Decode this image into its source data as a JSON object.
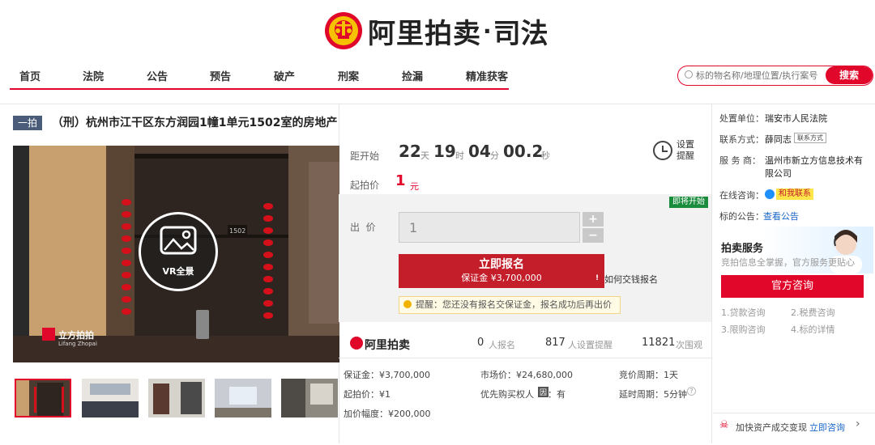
{
  "header": {
    "logo_text": "阿里拍卖",
    "logo_sep": "·",
    "logo_sub": "司法"
  },
  "nav": {
    "items": [
      "首页",
      "法院",
      "公告",
      "预告",
      "破产",
      "刑案",
      "捡漏",
      "精准获客"
    ]
  },
  "search": {
    "placeholder": "标的物名称/地理位置/执行案号",
    "button": "搜索"
  },
  "listing": {
    "badge": "一拍",
    "title": "（刑）杭州市江干区东方润园1幢1单元1502室的房地产"
  },
  "photo": {
    "vr_label": "VR全景",
    "watermark": "立方拍拍",
    "watermark_en": "Lifang Zhopai",
    "room_number": "1502"
  },
  "auction": {
    "countdown_label": "距开始",
    "days": "22",
    "days_unit": "天",
    "hours": "19",
    "hours_unit": "时",
    "minutes": "04",
    "minutes_unit": "分",
    "seconds": "00.2",
    "seconds_unit": "秒",
    "set_remind_1": "设置",
    "set_remind_2": "提醒",
    "start_label": "起拍价",
    "start_price": "1",
    "start_unit": "元",
    "soon_badge": "即将开始",
    "bid_label": "出  价",
    "bid_value": "1",
    "plus": "+",
    "minus": "−",
    "register_main": "立即报名",
    "register_sub": "保证金 ¥3,700,000",
    "how_text": "如何交钱报名",
    "remind_text": "提醒：您还没有报名交保证金，报名成功后再出价"
  },
  "stats": {
    "brand": "阿里拍卖",
    "registered_count": "0",
    "registered_label": "人报名",
    "remind_count": "817",
    "remind_label": "人设置提醒",
    "views_count": "11821",
    "views_label": "次围观"
  },
  "details": {
    "deposit": "保证金：¥3,700,000",
    "market": "市场价：¥24,680,000",
    "period": "竞价周期：1天",
    "start": "起拍价：¥1",
    "priority": "优先购买权人",
    "priority_badge": "因",
    "priority_val": "：有",
    "delay": "延时周期：5分钟",
    "increment": "加价幅度：¥200,000"
  },
  "sidebar": {
    "unit_label": "处置单位：",
    "unit": "瑞安市人民法院",
    "contact_label": "联系方式：",
    "contact_name": "薛同志",
    "contact_btn": "联系方式",
    "provider_label": "服 务 商：",
    "provider_1": "温州市新立方信息技术有",
    "provider_2": "限公司",
    "online_label": "在线咨询：",
    "online_btn": "和我联系",
    "notice_label": "标的公告：",
    "notice_link": "查看公告",
    "service_title": "拍卖服务",
    "service_desc": "竞拍信息全掌握，官方服务更贴心",
    "consult_btn": "官方咨询",
    "faq": [
      "1.贷款咨询",
      "2.税费咨询",
      "3.限购咨询",
      "4.标的详情"
    ],
    "speed_text": "加快资产成交变现",
    "speed_link": "立即咨询",
    "speed_arrow": "›"
  }
}
